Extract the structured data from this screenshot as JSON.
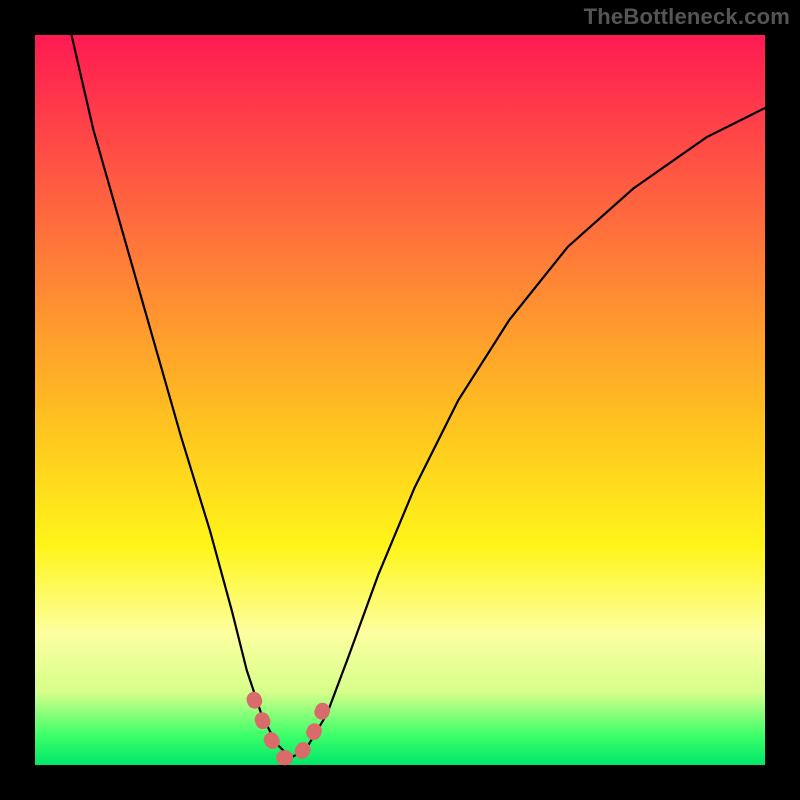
{
  "watermark": "TheBottleneck.com",
  "colors": {
    "frame_bg": "#000000",
    "watermark": "#555555",
    "curve": "#000000",
    "marker_stroke": "#d96b6b",
    "gradient_stops": [
      "#ff1a52",
      "#ff3a4a",
      "#ff6a3e",
      "#ff9a2e",
      "#ffc81e",
      "#fff51a",
      "#fdffa0",
      "#d6ff8a",
      "#3cff6a",
      "#00e66a"
    ]
  },
  "chart_data": {
    "type": "line",
    "title": "",
    "xlabel": "",
    "ylabel": "",
    "xlim": [
      0,
      100
    ],
    "ylim": [
      0,
      100
    ],
    "grid": false,
    "legend": false,
    "series": [
      {
        "name": "bottleneck-curve",
        "x": [
          5,
          8,
          12,
          16,
          20,
          24,
          27,
          29,
          31,
          33,
          35,
          37,
          40,
          43,
          47,
          52,
          58,
          65,
          73,
          82,
          92,
          100
        ],
        "y": [
          100,
          87,
          73,
          59,
          45,
          32,
          21,
          13,
          7,
          3,
          1,
          2,
          7,
          15,
          26,
          38,
          50,
          61,
          71,
          79,
          86,
          90
        ]
      }
    ],
    "annotations": [
      {
        "name": "valley-marker",
        "shape": "polyline",
        "x": [
          30,
          32,
          34,
          36,
          38,
          40
        ],
        "y": [
          9,
          4,
          1,
          1,
          4,
          9
        ]
      }
    ],
    "background_gradient": {
      "direction": "vertical",
      "stops": [
        {
          "pos": 0.0,
          "color": "#ff1a52"
        },
        {
          "pos": 0.1,
          "color": "#ff3a4a"
        },
        {
          "pos": 0.25,
          "color": "#ff6a3e"
        },
        {
          "pos": 0.4,
          "color": "#ff9a2e"
        },
        {
          "pos": 0.55,
          "color": "#ffc81e"
        },
        {
          "pos": 0.7,
          "color": "#fff51a"
        },
        {
          "pos": 0.82,
          "color": "#fdffa0"
        },
        {
          "pos": 0.9,
          "color": "#d6ff8a"
        },
        {
          "pos": 0.96,
          "color": "#3cff6a"
        },
        {
          "pos": 1.0,
          "color": "#00e66a"
        }
      ]
    }
  }
}
